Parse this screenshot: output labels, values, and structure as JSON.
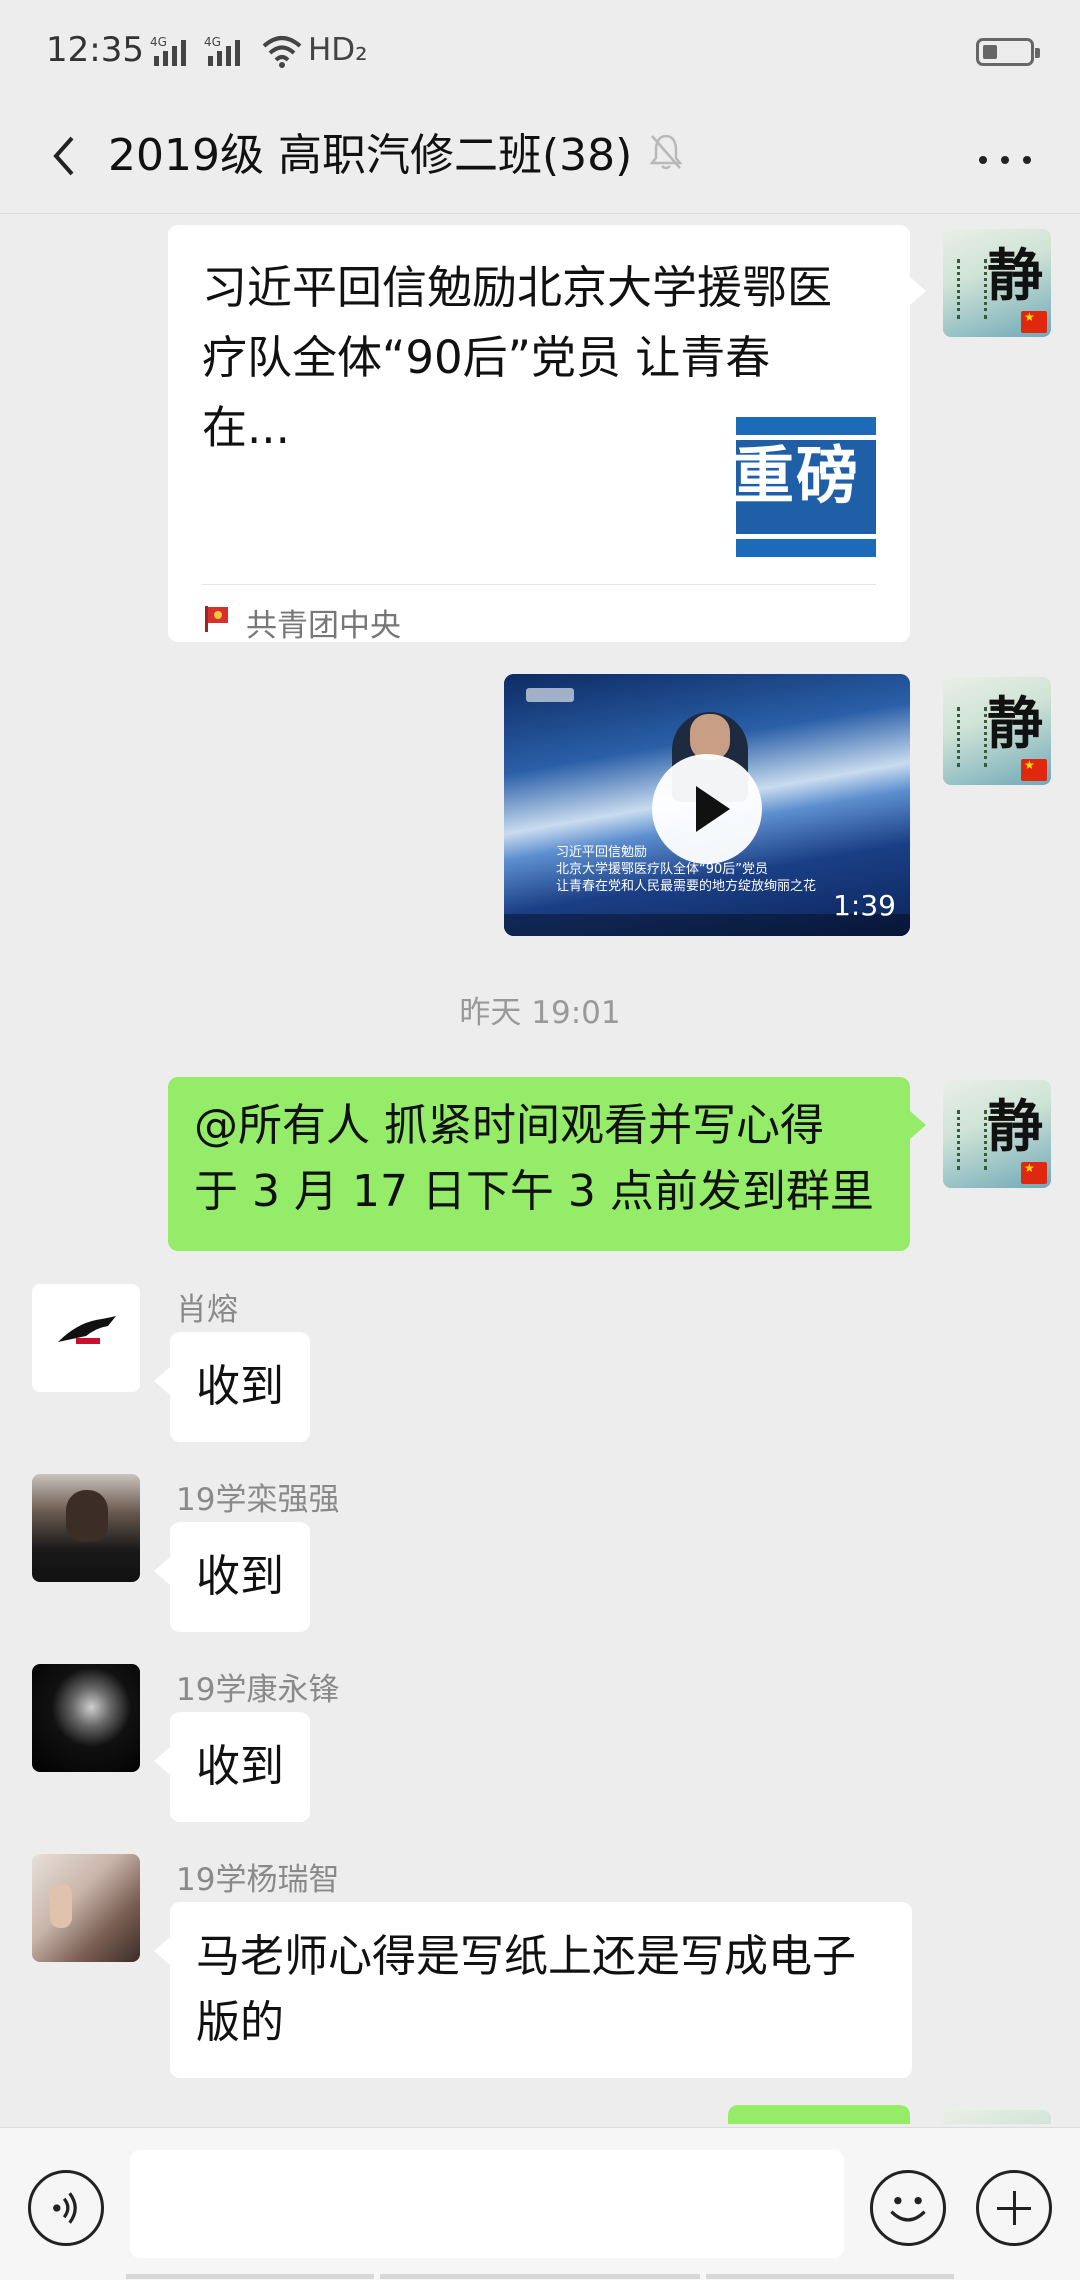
{
  "status_bar": {
    "time": "12:35",
    "network_1": "4G",
    "network_2": "4G",
    "hd": "HD₂",
    "battery_level": 0.2
  },
  "header": {
    "back_icon": "chevron-left-icon",
    "title": "2019级 高职汽修二班(38)",
    "mute_icon": "bell-muted-icon",
    "more_icon": "more-dots-icon"
  },
  "messages": {
    "article": {
      "title": "习近平回信勉励北京大学援鄂医疗队全体“90后”党员 让青春在...",
      "thumb_text": "重磅",
      "source": "共青团中央"
    },
    "video": {
      "caption_line1": "习近平回信勉励",
      "caption_line2": "北京大学援鄂医疗队全体“90后”党员",
      "caption_line3": "让青春在党和人民最需要的地方绽放绚丽之花",
      "duration": "1:39"
    },
    "timestamp": "昨天 19:01",
    "mine_text_1": "@所有人  抓紧时间观看并写心得",
    "mine_text_2": "于 3 月 17 日下午 3 点前发到群里",
    "replies": [
      {
        "sender": "肖熔",
        "text": "收到"
      },
      {
        "sender": "19学栾强强",
        "text": "收到"
      },
      {
        "sender": "19学康永锋",
        "text": "收到"
      },
      {
        "sender": "19学杨瑞智",
        "text_line1": "马老师心得是写纸上还是写成电子",
        "text_line2": "版的"
      }
    ],
    "my_avatar_char": "静"
  },
  "input_bar": {
    "voice_icon": "voice-icon",
    "emoji_icon": "emoji-icon",
    "plus_icon": "plus-icon"
  },
  "colors": {
    "background": "#EDEDED",
    "my_bubble": "#95EC69",
    "other_bubble": "#FFFFFF",
    "timestamp": "#999999"
  }
}
